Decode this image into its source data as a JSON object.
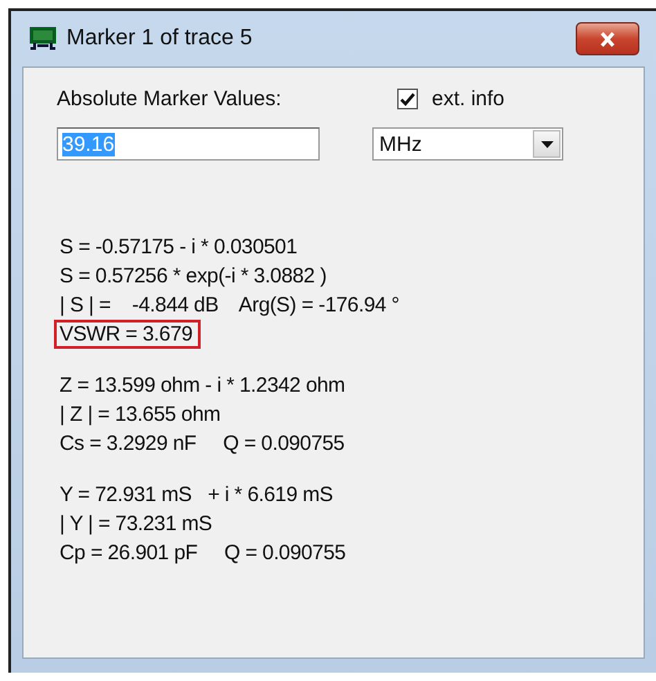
{
  "window": {
    "title": "Marker 1 of trace 5"
  },
  "header_label": "Absolute Marker Values:",
  "ext_info": {
    "label": "ext. info",
    "checked": true
  },
  "frequency_field": {
    "value": "39.16",
    "selected": true
  },
  "unit_dropdown": {
    "value": "MHz"
  },
  "groups": [
    {
      "lines": [
        {
          "text": "S = -0.57175 - i * 0.030501",
          "highlighted": false
        },
        {
          "text": "S = 0.57256 * exp(-i * 3.0882 )",
          "highlighted": false
        },
        {
          "text": "| S | =    -4.844 dB    Arg(S) = -176.94 °",
          "highlighted": false
        },
        {
          "text": "VSWR = 3.679",
          "highlighted": true
        }
      ]
    },
    {
      "lines": [
        {
          "text": "Z = 13.599 ohm - i * 1.2342 ohm",
          "highlighted": false
        },
        {
          "text": "| Z | = 13.655 ohm",
          "highlighted": false
        },
        {
          "text": "Cs = 3.2929 nF     Q = 0.090755",
          "highlighted": false
        }
      ]
    },
    {
      "lines": [
        {
          "text": "Y = 72.931 mS   + i * 6.619 mS",
          "highlighted": false
        },
        {
          "text": "| Y | = 73.231 mS",
          "highlighted": false
        },
        {
          "text": "Cp = 26.901 pF     Q = 0.090755",
          "highlighted": false
        }
      ]
    }
  ]
}
